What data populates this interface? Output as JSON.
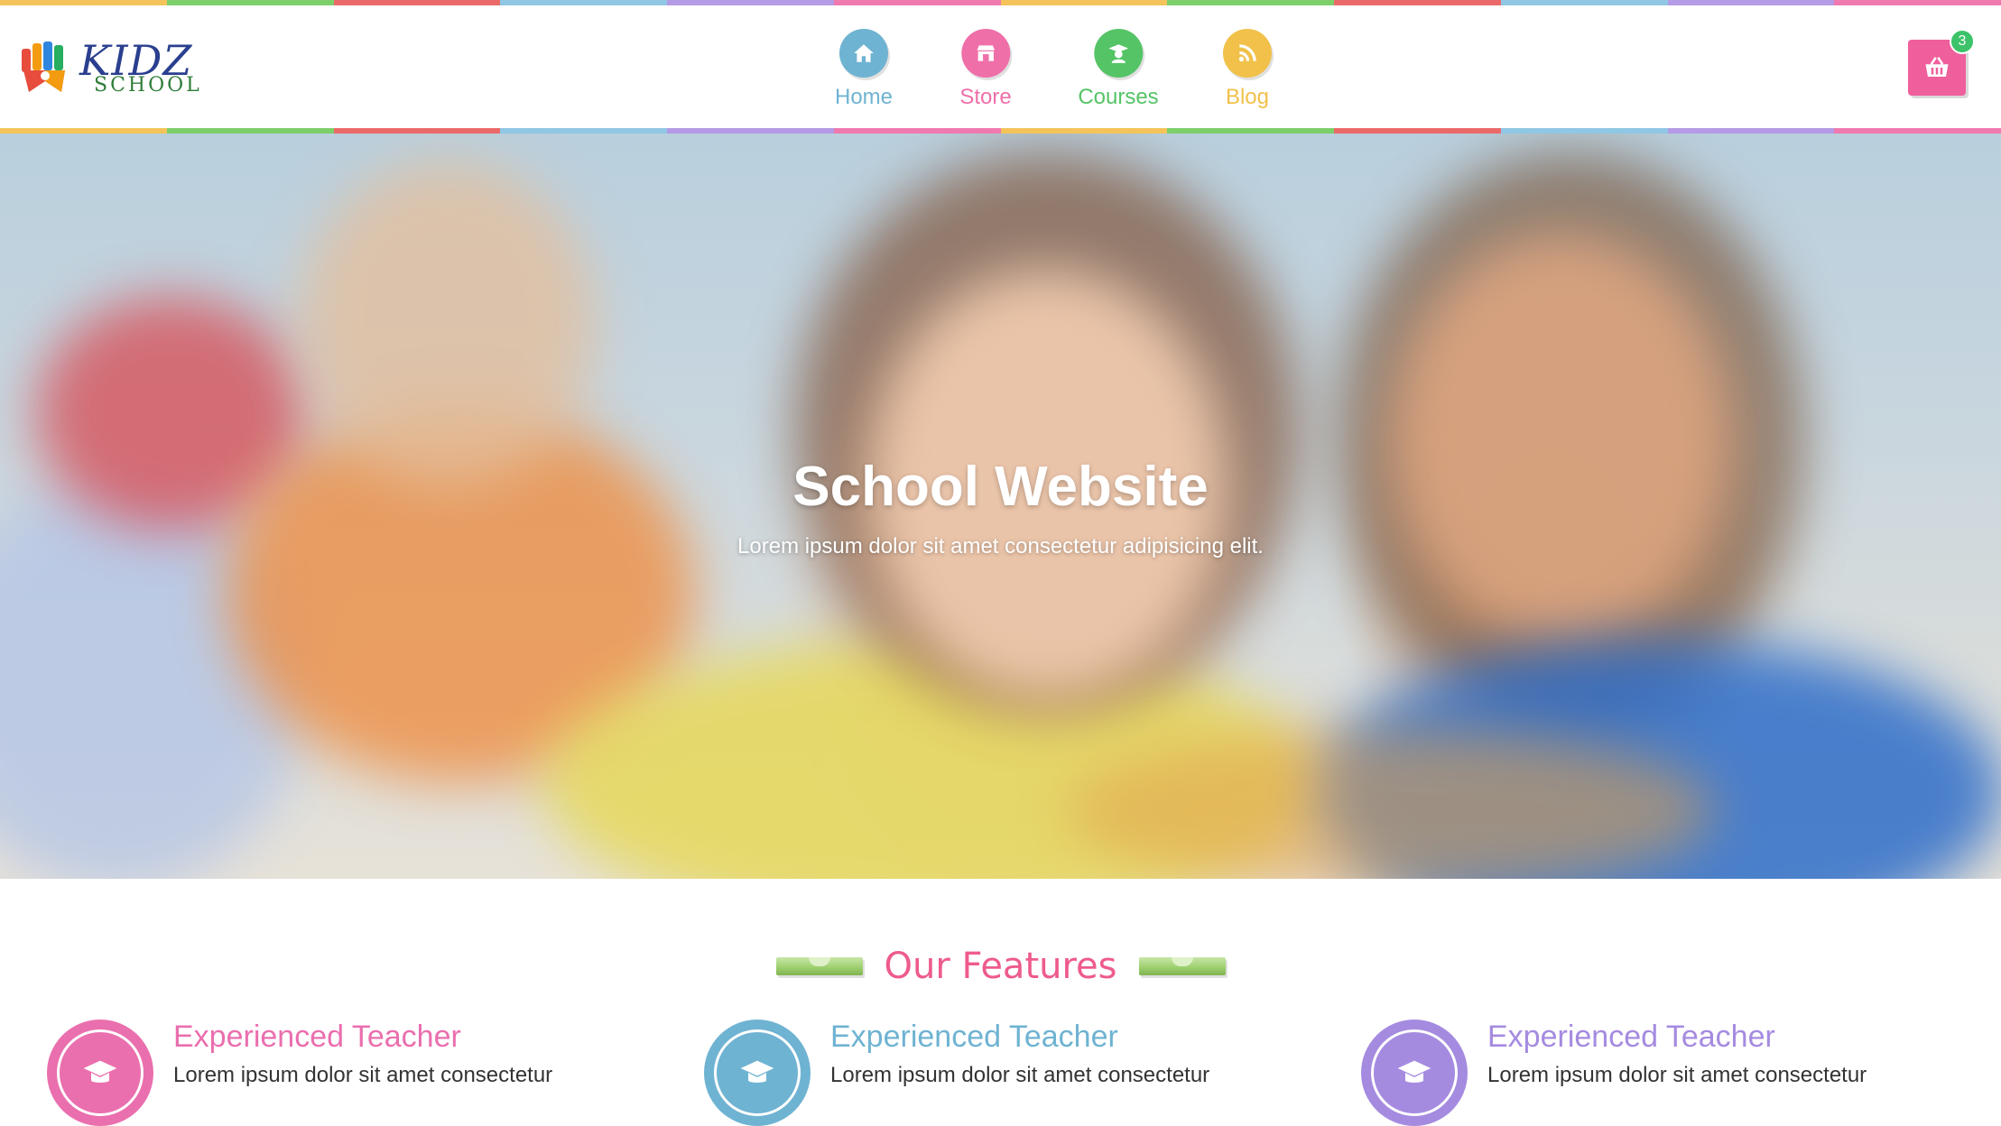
{
  "strip_colors": [
    "#f4c45a",
    "#7ccf6b",
    "#ea6a6a",
    "#8fc7e4",
    "#b49be6",
    "#ef7ab0",
    "#f4c45a",
    "#7ccf6b",
    "#ea6a6a",
    "#8fc7e4",
    "#b49be6",
    "#ef7ab0"
  ],
  "logo": {
    "brand": "KIDZ",
    "tagline": "SCHOOL"
  },
  "nav": {
    "items": [
      {
        "label": "Home",
        "icon": "home-icon",
        "color": "#6fb3d2"
      },
      {
        "label": "Store",
        "icon": "store-icon",
        "color": "#ef6fa9"
      },
      {
        "label": "Courses",
        "icon": "graduate-icon",
        "color": "#55c466"
      },
      {
        "label": "Blog",
        "icon": "rss-icon",
        "color": "#f1c14a"
      }
    ]
  },
  "cart": {
    "icon": "basket-icon",
    "count": "3",
    "color": "#ef5f9c"
  },
  "hero": {
    "title": "School Website",
    "subtitle": "Lorem ipsum dolor sit amet consectetur adipisicing elit."
  },
  "features": {
    "heading": "Our Features",
    "items": [
      {
        "title": "Experienced Teacher",
        "text": "Lorem ipsum dolor sit amet consectetur",
        "icon": "graduation-cap-icon",
        "color": "#ea6fae"
      },
      {
        "title": "Experienced Teacher",
        "text": "Lorem ipsum dolor sit amet consectetur",
        "icon": "graduation-cap-icon",
        "color": "#6fb3d2"
      },
      {
        "title": "Experienced Teacher",
        "text": "Lorem ipsum dolor sit amet consectetur",
        "icon": "graduation-cap-icon",
        "color": "#a58be0"
      }
    ]
  }
}
